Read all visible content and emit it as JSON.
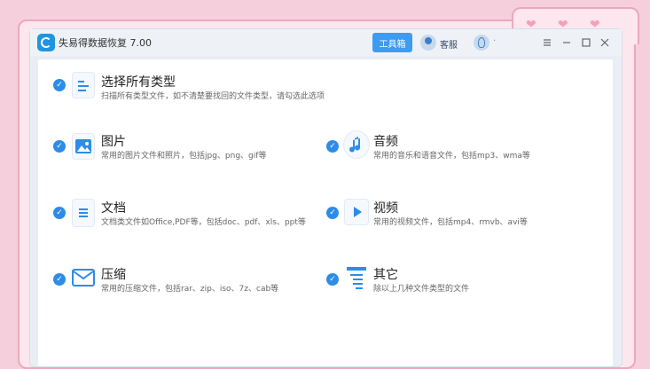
{
  "window": {
    "title": "失易得数据恢复 7.00",
    "toolbox_label": "工具箱",
    "service_label": "客服",
    "user_label": "·"
  },
  "options": [
    {
      "id": "all",
      "title": "选择所有类型",
      "desc": "扫描所有类型文件，如不清楚要找回的文件类型，请勾选此选项",
      "checked": true,
      "icon": "list-document-icon"
    },
    {
      "id": "image",
      "title": "图片",
      "desc": "常用的图片文件和照片，包括jpg、png、gif等",
      "checked": true,
      "icon": "picture-icon"
    },
    {
      "id": "audio",
      "title": "音频",
      "desc": "常用的音乐和语音文件，包括mp3、wma等",
      "checked": true,
      "icon": "music-note-icon"
    },
    {
      "id": "document",
      "title": "文档",
      "desc": "文档类文件如Office,PDF等，包括doc、pdf、xls、ppt等",
      "checked": true,
      "icon": "document-icon"
    },
    {
      "id": "video",
      "title": "视频",
      "desc": "常用的视频文件，包括mp4、rmvb、avi等",
      "checked": true,
      "icon": "video-play-icon"
    },
    {
      "id": "archive",
      "title": "压缩",
      "desc": "常用的压缩文件，包括rar、zip、iso、7z、cab等",
      "checked": true,
      "icon": "envelope-icon"
    },
    {
      "id": "other",
      "title": "其它",
      "desc": "除以上几种文件类型的文件",
      "checked": true,
      "icon": "other-files-icon"
    }
  ],
  "colors": {
    "accent": "#2d8ce8",
    "toolbox_button": "#3d9cf0",
    "background_pink": "#f6cfdc"
  }
}
